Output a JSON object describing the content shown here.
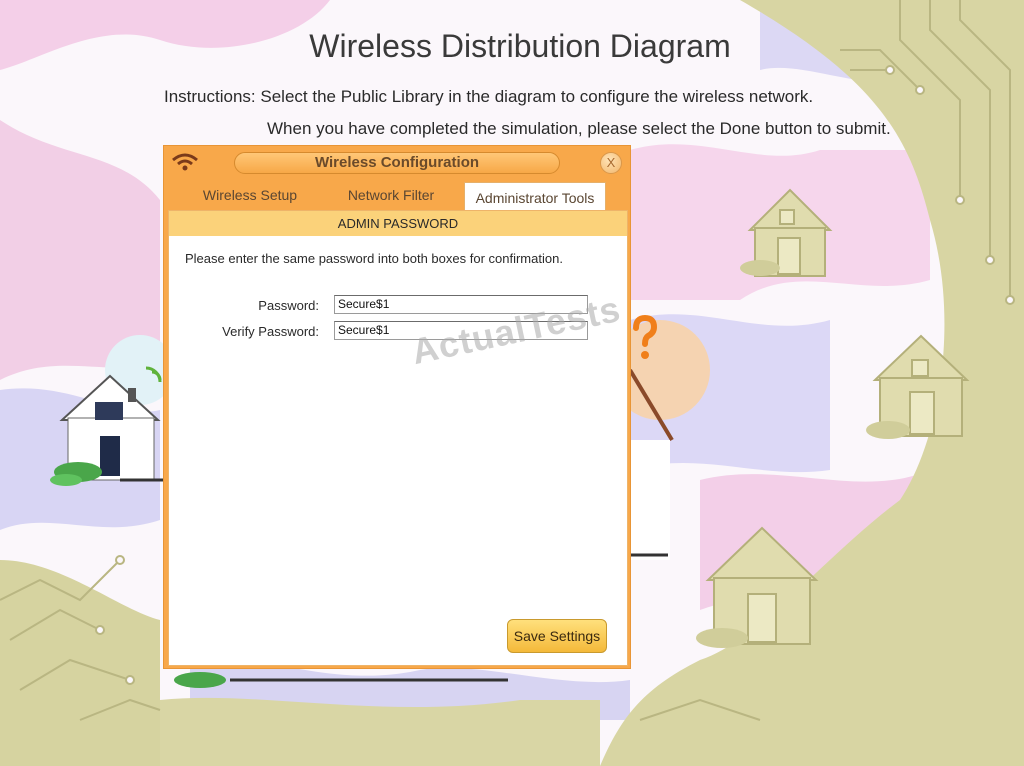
{
  "page": {
    "title": "Wireless Distribution Diagram",
    "instruction_1": "Instructions: Select the Public Library in the diagram to configure the wireless network.",
    "instruction_2": "When you have completed the simulation, please select the Done button to submit.",
    "watermark": "ActualTests"
  },
  "dialog": {
    "title": "Wireless Configuration",
    "close_label": "X",
    "tabs": [
      {
        "label": "Wireless Setup",
        "active": false
      },
      {
        "label": "Network Filter",
        "active": false
      },
      {
        "label": "Administrator Tools",
        "active": true
      }
    ],
    "section_header": "ADMIN PASSWORD",
    "instruction": "Please enter the same password into both boxes for confirmation.",
    "password_label": "Password:",
    "password_value": "Secure$1",
    "verify_label": "Verify Password:",
    "verify_value": "Secure$1",
    "save_label": "Save Settings"
  },
  "colors": {
    "dialog_orange": "#f8a84a",
    "section_yellow": "#fbd27a",
    "button_yellow": "#f4b93a",
    "background_olive": "#d6d3a0",
    "background_lavender": "#d9d6f4",
    "background_pink": "#f6d4ec"
  },
  "icons": [
    "wifi-icon",
    "close-icon",
    "question-mark-icon",
    "house-icon"
  ]
}
